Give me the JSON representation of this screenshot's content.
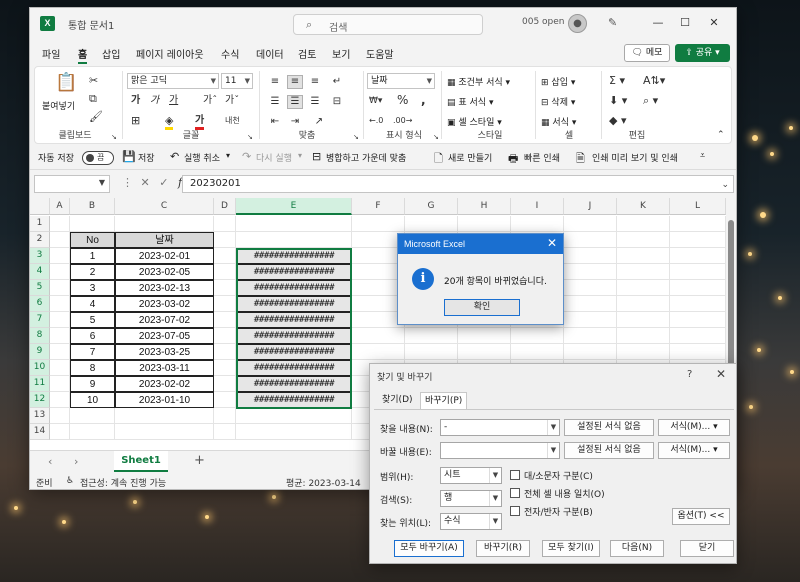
{
  "window": {
    "doc_title": "통합 문서1",
    "search_placeholder": "검색",
    "account": "005 open",
    "minimize": "—",
    "maximize": "☐",
    "close": "✕"
  },
  "menu": {
    "items": [
      "파일",
      "홈",
      "삽입",
      "페이지 레이아웃",
      "수식",
      "데이터",
      "검토",
      "보기",
      "도움말"
    ],
    "active": "홈",
    "memo": "메모",
    "share": "공유"
  },
  "ribbon": {
    "clipboard": {
      "paste": "붙여넣기",
      "label": "클립보드"
    },
    "font": {
      "name": "맑은 고딕",
      "size": "11",
      "label": "글꼴"
    },
    "alignment": {
      "label": "맞춤"
    },
    "number": {
      "format": "날짜",
      "label": "표시 형식"
    },
    "styles": {
      "conditional": "조건부 서식",
      "table": "표 서식",
      "cell": "셀 스타일",
      "label": "스타일"
    },
    "cells": {
      "insert": "삽입",
      "delete": "삭제",
      "format": "서식",
      "label": "셀"
    },
    "editing": {
      "label": "편집"
    }
  },
  "qat": {
    "autosave": "자동 저장",
    "toggle": "끔",
    "save": "저장",
    "undo": "실행 취소",
    "redo": "다시 실행",
    "merge": "병합하고 가운데 맞춤",
    "new": "새로 만들기",
    "quickprint": "빠른 인쇄",
    "preview": "인쇄 미리 보기 및 인쇄"
  },
  "formula": {
    "value": "20230201"
  },
  "grid": {
    "columns": [
      "A",
      "B",
      "C",
      "D",
      "E",
      "F",
      "G",
      "H",
      "I",
      "J",
      "K",
      "L"
    ],
    "rows": [
      "1",
      "2",
      "3",
      "4",
      "5",
      "6",
      "7",
      "8",
      "9",
      "10",
      "11",
      "12",
      "13",
      "14"
    ],
    "table_headers": [
      "No",
      "날짜"
    ],
    "table_rows": [
      [
        "1",
        "2023-02-01"
      ],
      [
        "2",
        "2023-02-05"
      ],
      [
        "3",
        "2023-02-13"
      ],
      [
        "4",
        "2023-03-02"
      ],
      [
        "5",
        "2023-07-02"
      ],
      [
        "6",
        "2023-07-05"
      ],
      [
        "7",
        "2023-03-25"
      ],
      [
        "8",
        "2023-03-11"
      ],
      [
        "9",
        "2023-02-02"
      ],
      [
        "10",
        "2023-01-10"
      ]
    ],
    "overflow_text": "################"
  },
  "sheets": {
    "tabs": [
      "Sheet1"
    ],
    "add": "+"
  },
  "status": {
    "ready": "준비",
    "accessibility": "접근성: 계속 진행 가능",
    "average": "평균: 2023-03-14"
  },
  "msgbox": {
    "title": "Microsoft Excel",
    "message": "20개 항목이 바뀌었습니다.",
    "ok": "확인"
  },
  "find_replace": {
    "title": "찾기 및 바꾸기",
    "help": "?",
    "tabs": [
      "찾기(D)",
      "바꾸기(P)"
    ],
    "find_label": "찾을 내용(N):",
    "find_value": "-",
    "replace_label": "바꿀 내용(E):",
    "replace_value": "",
    "no_format": "설정된 서식 없음",
    "format_btn": "서식(M)...",
    "within_label": "범위(H):",
    "within_value": "시트",
    "search_label": "검색(S):",
    "search_value": "행",
    "lookin_label": "찾는 위치(L):",
    "lookin_value": "수식",
    "match_case": "대/소문자 구분(C)",
    "match_entire": "전체 셀 내용 일치(O)",
    "match_byte": "전자/반자 구분(B)",
    "options": "옵션(T) <<",
    "buttons": [
      "모두 바꾸기(A)",
      "바꾸기(R)",
      "모두 찾기(I)",
      "다음(N)",
      "닫기"
    ]
  }
}
